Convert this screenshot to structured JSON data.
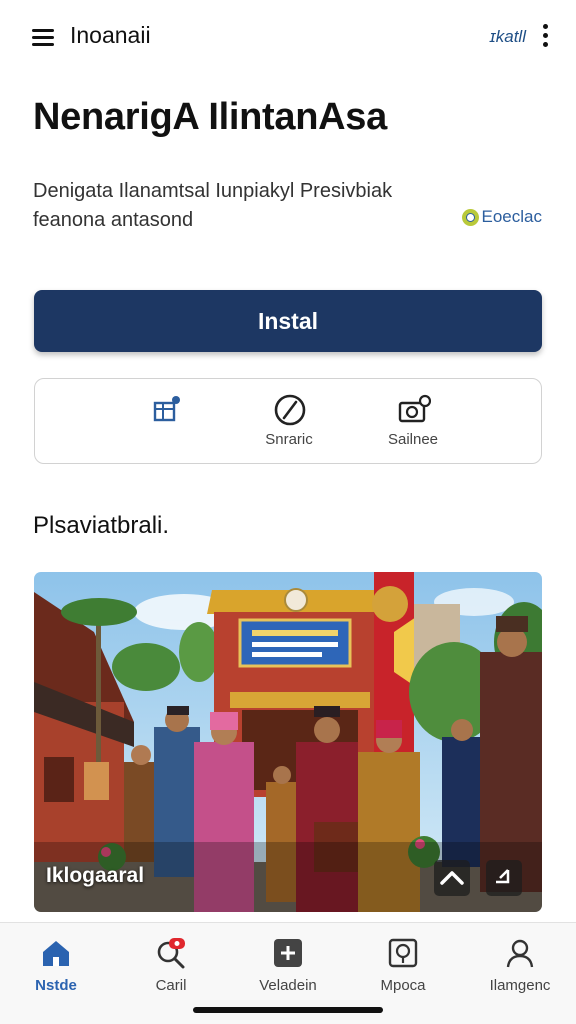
{
  "header": {
    "app_title": "Inoanaii",
    "top_link": "ɪkatll",
    "menu_icon": "menu-icon",
    "more_icon": "more-vertical-icon"
  },
  "main": {
    "title": "NenarigA IlintanAsa",
    "description": "Denigata Ilanamtsal Iunpiakyl Presivbiak feanona antasond",
    "tag_label": "Eoeclac",
    "install_label": "Instal",
    "actions": [
      {
        "icon": "open-external-icon",
        "label": ""
      },
      {
        "icon": "block-icon",
        "label": "Snraric"
      },
      {
        "icon": "camera-icon",
        "label": "Sailnee"
      }
    ],
    "section_title": "Plsaviatbrali.",
    "photo_caption": "Iklogaaral"
  },
  "bottom_nav": [
    {
      "icon": "home-icon",
      "label": "Nstde",
      "active": true
    },
    {
      "icon": "search-icon",
      "label": "Caril",
      "active": false
    },
    {
      "icon": "add-icon",
      "label": "Veladein",
      "active": false
    },
    {
      "icon": "profile-frame-icon",
      "label": "Mpoca",
      "active": false
    },
    {
      "icon": "person-icon",
      "label": "Ilamgenc",
      "active": false
    }
  ],
  "colors": {
    "primary": "#1d3763",
    "accent": "#2b63b0",
    "badge_red": "#e0282e"
  }
}
